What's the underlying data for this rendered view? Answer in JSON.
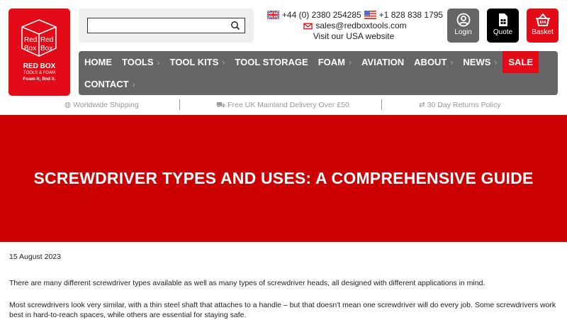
{
  "logo": {
    "brand": "RED BOX",
    "sub": "TOOLS & FOAM",
    "tagline": "Foam it, find it.",
    "cube_text": "Red Box"
  },
  "search": {
    "placeholder": "",
    "value": ""
  },
  "contact": {
    "uk_phone": "+44 (0) 2380 254285",
    "us_phone": "+1 828 838 1795",
    "email": "sales@redboxtools.com",
    "usa_link": "Visit our USA website"
  },
  "buttons": {
    "login": "Login",
    "quote": "Quote",
    "basket": "Basket"
  },
  "nav": [
    {
      "label": "HOME",
      "chevron": false
    },
    {
      "label": "TOOLS",
      "chevron": true
    },
    {
      "label": "TOOL KITS",
      "chevron": true
    },
    {
      "label": "TOOL STORAGE",
      "chevron": false
    },
    {
      "label": "FOAM",
      "chevron": true
    },
    {
      "label": "AVIATION",
      "chevron": false
    },
    {
      "label": "ABOUT",
      "chevron": true
    },
    {
      "label": "NEWS",
      "chevron": true
    },
    {
      "label": "SALE",
      "chevron": false
    },
    {
      "label": "CONTACT",
      "chevron": true
    }
  ],
  "usp": [
    "Worldwide Shipping",
    "Free UK Mainland Delivery Over £50",
    "30 Day Returns Policy"
  ],
  "hero": {
    "title": "SCREWDRIVER TYPES AND USES: A COMPREHENSIVE GUIDE"
  },
  "article": {
    "date": "15 August 2023",
    "paragraphs": [
      "There are many different screwdriver types available as well as many types of screwdriver heads, all designed with different applications in mind.",
      "Most screwdrivers look very similar, with a thin steel shaft that attaches to a handle – but that doesn't mean one screwdriver will do every job. Some screwdrivers work best in hard-to-reach spaces, while others are essential for staying safe."
    ]
  },
  "colors": {
    "brand_red": "#e30b17",
    "hero_red": "#cc0000",
    "nav_grey": "#666666"
  }
}
